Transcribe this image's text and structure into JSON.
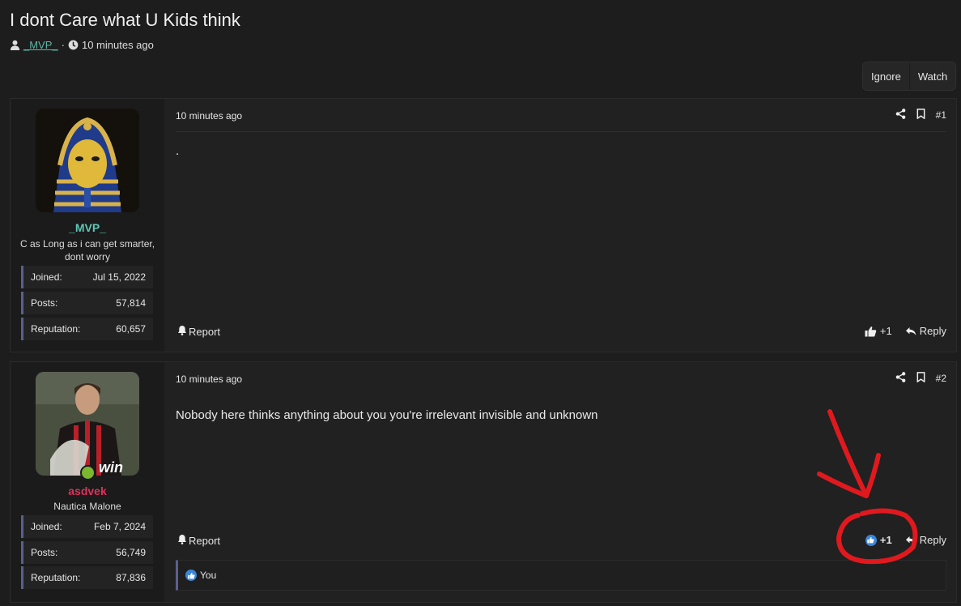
{
  "thread": {
    "title": "I dont Care what U Kids think",
    "author": "_MVP_",
    "separator": "·",
    "time": "10 minutes ago"
  },
  "thread_actions": {
    "ignore": "Ignore",
    "watch": "Watch"
  },
  "posts": [
    {
      "user": {
        "name": "_MVP_",
        "name_color": "#5fc7b6",
        "title": "C as Long as i can get smarter, dont worry",
        "stats": [
          {
            "label": "Joined:",
            "value": "Jul 15, 2022"
          },
          {
            "label": "Posts:",
            "value": "57,814"
          },
          {
            "label": "Reputation:",
            "value": "60,657"
          }
        ]
      },
      "time": "10 minutes ago",
      "number": "#1",
      "content": ".",
      "report": "Report",
      "reactions": "+1",
      "reply": "Reply"
    },
    {
      "user": {
        "name": "asdvek",
        "name_color": "#e0315a",
        "title": "Nautica Malone",
        "stats": [
          {
            "label": "Joined:",
            "value": "Feb 7, 2024"
          },
          {
            "label": "Posts:",
            "value": "56,749"
          },
          {
            "label": "Reputation:",
            "value": "87,836"
          }
        ]
      },
      "time": "10 minutes ago",
      "number": "#2",
      "content": "Nobody here thinks anything about you you're irrelevant invisible and unknown",
      "report": "Report",
      "reactions": "+1",
      "reply": "Reply",
      "likes_by": "You"
    }
  ],
  "colors": {
    "annotation": "#e0191e",
    "like_blue": "#3a86d9",
    "stat_border": "#5b5f8f"
  }
}
